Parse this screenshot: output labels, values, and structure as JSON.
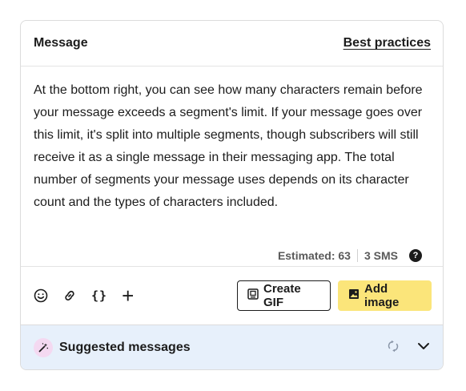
{
  "header": {
    "title": "Message",
    "link_label": "Best practices"
  },
  "message": {
    "body": "At the bottom right, you can see how many characters remain before your message exceeds a segment's limit. If your message goes over this limit, it's split into multiple segments, though subscribers will still receive it as a single message in their messaging app. The total number of segments your message uses depends on its character count and the types of characters included."
  },
  "counter": {
    "estimated": "Estimated: 63",
    "sms": "3 SMS",
    "help_glyph": "?"
  },
  "toolbar": {
    "icons": [
      "emoji-icon",
      "link-icon",
      "variable-braces-icon",
      "add-icon"
    ],
    "braces_glyph": "{}",
    "plus_glyph": "+",
    "create_gif_label": "Create GIF",
    "add_image_label": "Add image"
  },
  "suggested": {
    "label": "Suggested messages",
    "icons": [
      "magic-wand-icon",
      "refresh-icon",
      "chevron-down-icon"
    ]
  },
  "colors": {
    "add_image_bg": "#fbe57a",
    "suggested_bg": "#e7f0fb",
    "wand_bg": "#f4d9f1",
    "text": "#1c1c1c"
  }
}
